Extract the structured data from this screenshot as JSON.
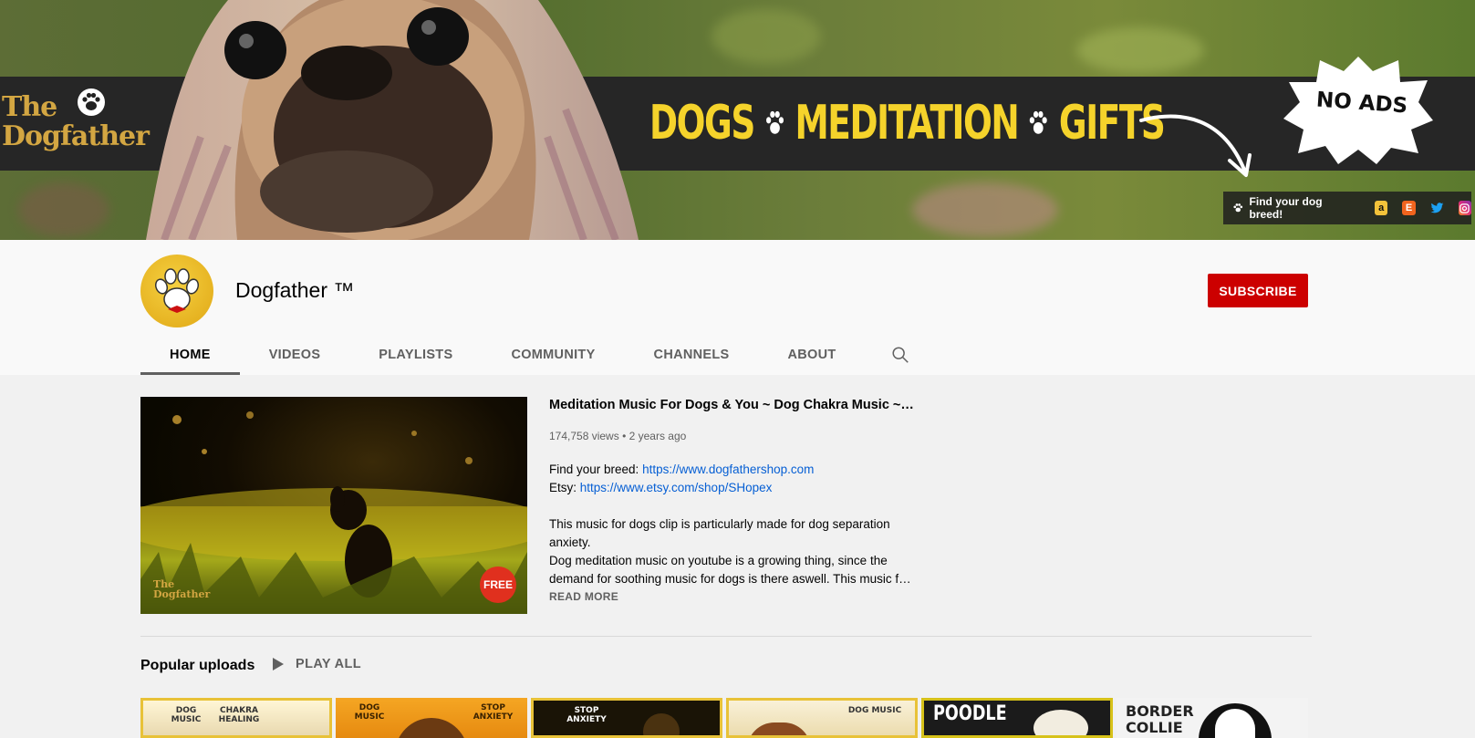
{
  "banner": {
    "logo_line1": "The",
    "logo_line2": "Dogfather",
    "tagline": [
      "DOGS",
      "MEDITATION",
      "GIFTS"
    ],
    "badge": "NO ADS",
    "find_breed": "Find your dog breed!"
  },
  "channel": {
    "name": "Dogfather ™",
    "subscribe_label": "SUBSCRIBE"
  },
  "tabs": [
    {
      "label": "HOME",
      "active": true
    },
    {
      "label": "VIDEOS"
    },
    {
      "label": "PLAYLISTS"
    },
    {
      "label": "COMMUNITY"
    },
    {
      "label": "CHANNELS"
    },
    {
      "label": "ABOUT"
    }
  ],
  "featured": {
    "title": "Meditation Music For Dogs & You ~ Dog Chakra Music ~ Music for Separation Anxiety",
    "views": "174,758 views",
    "age": "2 years ago",
    "breed_label": "Find your breed: ",
    "breed_link": "https://www.dogfathershop.com",
    "etsy_label": "Etsy: ",
    "etsy_link": "https://www.etsy.com/shop/SHopex",
    "para1": "This music for dogs clip is particularly made for dog separation anxiety.",
    "para2a": "Dog meditation music on youtube is a growing thing, since the",
    "para2b": "demand for soothing music for dogs is there aswell. This music for dogs",
    "read_more": "READ MORE",
    "thumb_badge": "FREE",
    "thumb_logo1": "The",
    "thumb_logo2": "Dogfather"
  },
  "popular": {
    "title": "Popular uploads",
    "play_all": "PLAY ALL",
    "thumbs": [
      {
        "left": "DOG MUSIC",
        "right": "CHAKRA HEALING"
      },
      {
        "left": "DOG MUSIC",
        "right": "STOP ANXIETY"
      },
      {
        "left": "STOP ANXIETY",
        "right": ""
      },
      {
        "left": "",
        "right": "DOG MUSIC"
      },
      {
        "left": "POODLE",
        "right": ""
      },
      {
        "left": "BORDER COLLIE",
        "right": ""
      }
    ]
  },
  "colors": {
    "subscribe": "#cc0000",
    "link": "#065fd4",
    "tagline": "#f5d32b",
    "logo_gold": "#d3a642"
  }
}
